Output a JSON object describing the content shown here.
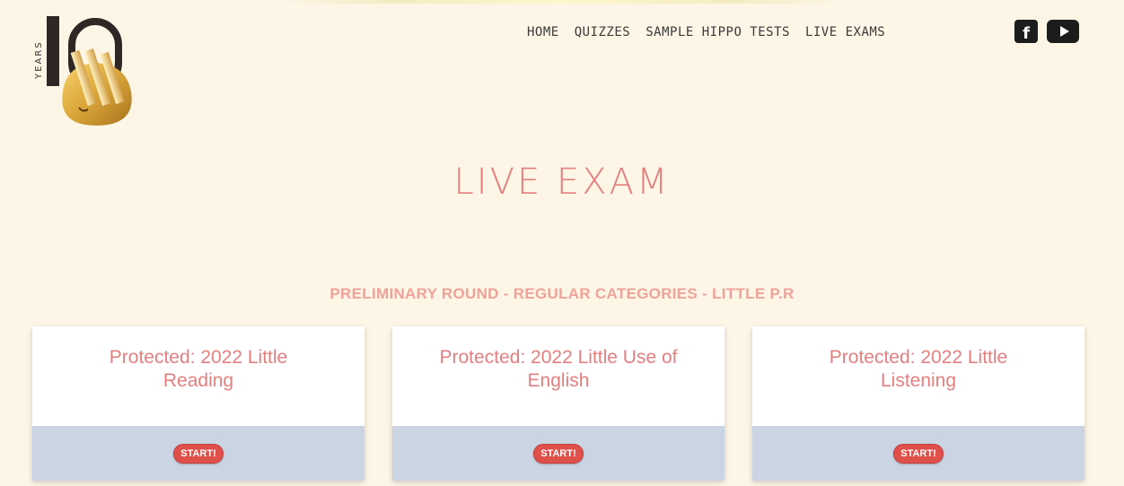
{
  "logo": {
    "years_text": "YEARS",
    "number_text": "10"
  },
  "nav": {
    "items": [
      {
        "label": "HOME"
      },
      {
        "label": "QUIZZES"
      },
      {
        "label": "SAMPLE HIPPO TESTS"
      },
      {
        "label": "LIVE EXAMS"
      }
    ]
  },
  "social": {
    "facebook_glyph": "f",
    "icons": [
      "facebook-icon",
      "youtube-icon"
    ]
  },
  "page": {
    "title": "LIVE EXAM",
    "section_title": "PRELIMINARY ROUND - REGULAR CATEGORIES - LITTLE P.R"
  },
  "cards": [
    {
      "title": "Protected: 2022 Little Reading",
      "button_label": "START!"
    },
    {
      "title": "Protected: 2022 Little Use of English",
      "button_label": "START!"
    },
    {
      "title": "Protected: 2022 Little Listening",
      "button_label": "START!"
    }
  ],
  "colors": {
    "background": "#fdf5e6",
    "accent": "#e57f7f",
    "card_footer": "#cbd4e3",
    "button": "#e0504a"
  }
}
